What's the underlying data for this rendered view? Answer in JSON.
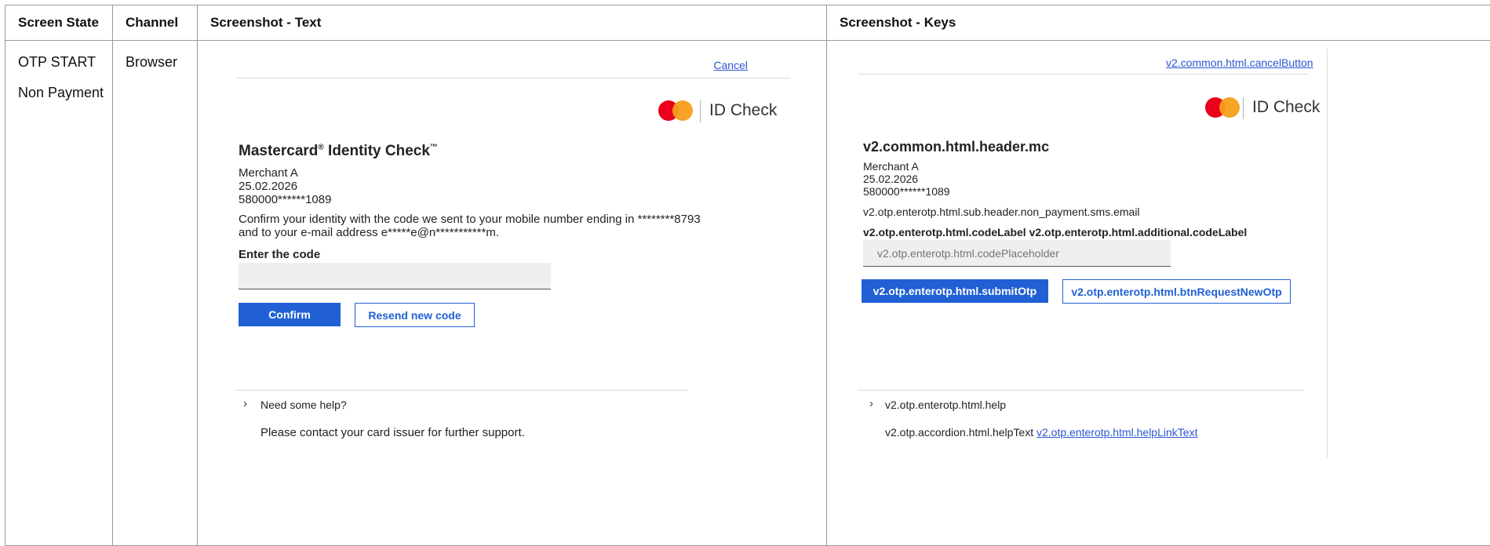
{
  "table": {
    "headers": [
      "Screen State",
      "Channel",
      "Screenshot - Text",
      "Screenshot - Keys"
    ],
    "row": {
      "screen_state": [
        "OTP START",
        "Non Payment"
      ],
      "channel": "Browser"
    }
  },
  "text_shot": {
    "cancel": "Cancel",
    "brand": "ID Check",
    "title": "Mastercard",
    "title_reg": "®",
    "title_mid": " Identity Check",
    "title_tm": "™",
    "merchant": "Merchant A",
    "date": "25.02.2026",
    "card": "580000******1089",
    "message_line1": "Confirm your identity with the code we sent to your mobile number ending in ********8793",
    "message_line2": "and to your e-mail address e*****e@n***********m.",
    "code_label": "Enter the code",
    "code_placeholder": "",
    "confirm": "Confirm",
    "resend": "Resend new code",
    "help": "Need some help?",
    "help_text": "Please contact your card issuer for further support."
  },
  "keys_shot": {
    "cancel": "v2.common.html.cancelButton",
    "brand": "ID Check",
    "title": "v2.common.html.header.mc",
    "merchant": "Merchant A",
    "date": "25.02.2026",
    "card": "580000******1089",
    "subheader": "v2.otp.enterotp.html.sub.header.non_payment.sms.email",
    "code_label": "v2.otp.enterotp.html.codeLabel v2.otp.enterotp.html.additional.codeLabel",
    "code_placeholder": "v2.otp.enterotp.html.codePlaceholder",
    "submit": "v2.otp.enterotp.html.submitOtp",
    "request_new": "v2.otp.enterotp.html.btnRequestNewOtp",
    "help": "v2.otp.enterotp.html.help",
    "help_text": "v2.otp.accordion.html.helpText",
    "help_link": "v2.otp.enterotp.html.helpLinkText"
  },
  "colors": {
    "primary_blue": "#2160d4",
    "mc_red": "#eb001b",
    "mc_orange": "#f79e1b"
  },
  "icons": {
    "chevron": "›"
  }
}
